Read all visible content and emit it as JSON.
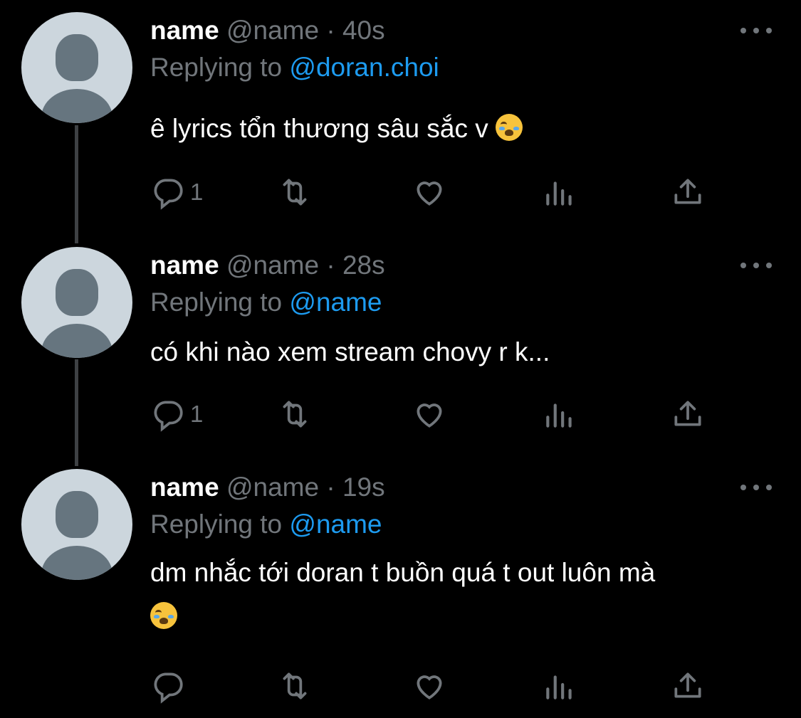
{
  "tweets": [
    {
      "name": "name",
      "handle": "@name",
      "separator": "·",
      "time": "40s",
      "replying_prefix": "Replying to",
      "replying_to": "@doran.choi",
      "text": "ê lyrics tổn thương sâu sắc v",
      "emoji": "loudly-crying-face",
      "reply_count": "1"
    },
    {
      "name": "name",
      "handle": "@name",
      "separator": "·",
      "time": "28s",
      "replying_prefix": "Replying to",
      "replying_to": "@name",
      "text": "có khi nào xem stream chovy r k...",
      "reply_count": "1"
    },
    {
      "name": "name",
      "handle": "@name",
      "separator": "·",
      "time": "19s",
      "replying_prefix": "Replying to",
      "replying_to": "@name",
      "text": "dm nhắc tới doran t buồn quá t out luôn mà",
      "emoji": "loudly-crying-face",
      "reply_count": ""
    }
  ],
  "icons": [
    "reply-icon",
    "retweet-icon",
    "like-icon",
    "views-icon",
    "share-icon",
    "more-icon"
  ],
  "colors": {
    "background": "#000000",
    "text": "#ffffff",
    "muted": "#71767b",
    "link": "#1d9bf0",
    "avatar": "#ccd6dd"
  }
}
